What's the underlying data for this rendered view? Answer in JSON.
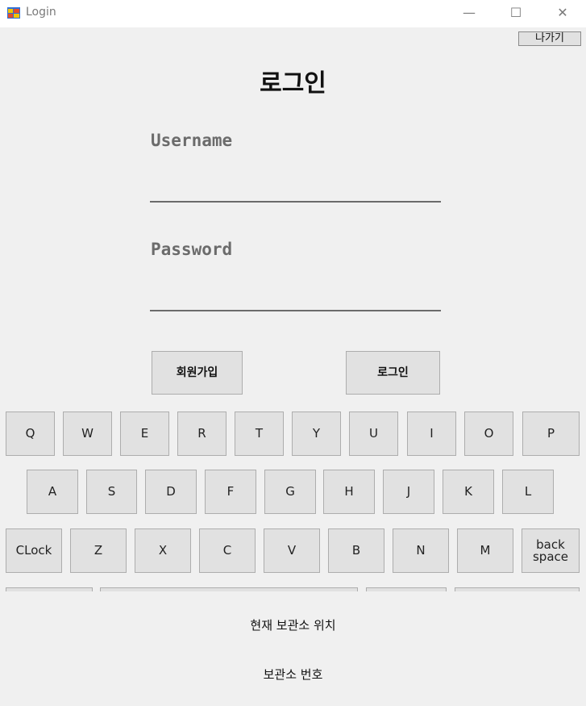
{
  "window": {
    "title": "Login",
    "minimize_glyph": "—",
    "maximize_glyph": "☐",
    "close_glyph": "✕"
  },
  "header": {
    "exit_label": "나가기"
  },
  "main": {
    "title": "로그인",
    "username_label": "Username",
    "username_value": "",
    "password_label": "Password",
    "password_value": "",
    "signup_label": "회원가입",
    "login_label": "로그인"
  },
  "keyboard": {
    "row1": [
      "Q",
      "W",
      "E",
      "R",
      "T",
      "Y",
      "U",
      "I",
      "O",
      "P"
    ],
    "row2": [
      "A",
      "S",
      "D",
      "F",
      "G",
      "H",
      "J",
      "K",
      "L"
    ],
    "row3": [
      "CLock",
      "Z",
      "X",
      "C",
      "V",
      "B",
      "N",
      "M",
      "back\nspace"
    ],
    "row4_visible_keys": 4
  },
  "footer": {
    "location_text": "현재 보관소 위치",
    "locker_number_text": "보관소 번호"
  }
}
